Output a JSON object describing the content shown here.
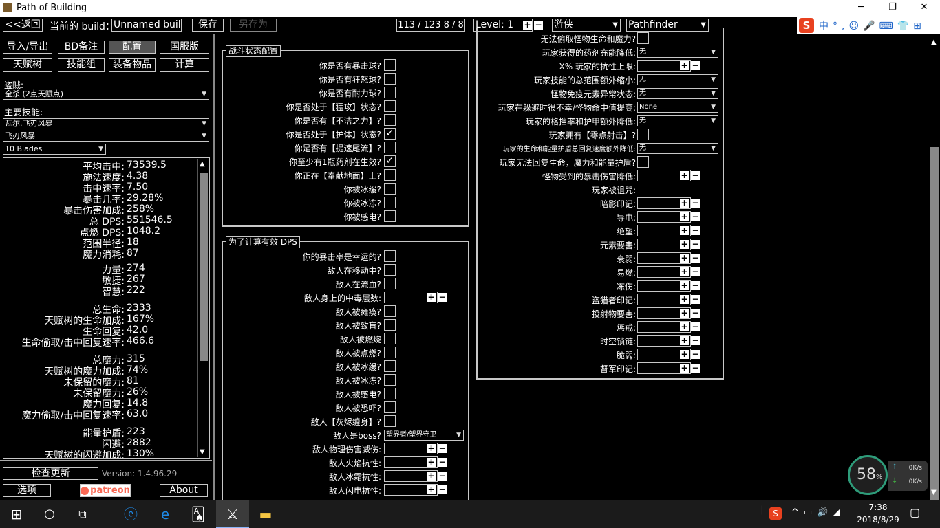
{
  "window": {
    "title": "Path of Building",
    "min": "─",
    "max": "❐",
    "close": "✕"
  },
  "toolbar": {
    "back": "<<返回",
    "build_label": "当前的 build：",
    "build_name": "Unnamed build",
    "save": "保存",
    "save_as": "另存为",
    "points": "113 / 123   8 / 8",
    "level": "Level: 1",
    "class": "游侠",
    "ascendancy": "Pathfinder"
  },
  "left": {
    "tabs1": [
      "导入/导出",
      "BD备注",
      "配置",
      "国服版"
    ],
    "tabs2": [
      "天赋树",
      "技能组",
      "装备物品",
      "计算"
    ],
    "bandit_label": "盗贼:",
    "bandit_value": "全杀 (2点天赋点)",
    "skill_label": "主要技能:",
    "skill1": "瓦尔.飞刃风暴",
    "skill2": "飞刃风暴",
    "skill3": "10 Blades",
    "check_update": "检查更新",
    "version": "Version: 1.4.96.29",
    "options": "选项",
    "patreon": "patreon",
    "about": "About"
  },
  "stats": [
    {
      "k": "平均击中:",
      "v": "73539.5"
    },
    {
      "k": "施法速度:",
      "v": "4.38"
    },
    {
      "k": "击中速率:",
      "v": "7.50"
    },
    {
      "k": "暴击几率:",
      "v": "29.28%"
    },
    {
      "k": "暴击伤害加成:",
      "v": "258%"
    },
    {
      "k": "总 DPS:",
      "v": "551546.5"
    },
    {
      "k": "点燃 DPS:",
      "v": "1048.2"
    },
    {
      "k": "范围半径:",
      "v": "18"
    },
    {
      "k": "魔力消耗:",
      "v": "87"
    },
    {
      "k": "力量:",
      "v": "274"
    },
    {
      "k": "敏捷:",
      "v": "267"
    },
    {
      "k": "智慧:",
      "v": "222"
    },
    {
      "k": "总生命:",
      "v": "2333"
    },
    {
      "k": "天赋树的生命加成:",
      "v": "167%"
    },
    {
      "k": "生命回复:",
      "v": "42.0"
    },
    {
      "k": "生命偷取/击中回复速率:",
      "v": "466.6"
    },
    {
      "k": "总魔力:",
      "v": "315"
    },
    {
      "k": "天赋树的魔力加成:",
      "v": "74%"
    },
    {
      "k": "未保留的魔力:",
      "v": "81"
    },
    {
      "k": "未保留魔力:",
      "v": "26%"
    },
    {
      "k": "魔力回复:",
      "v": "14.8"
    },
    {
      "k": "魔力偷取/击中回复速率:",
      "v": "63.0"
    },
    {
      "k": "能量护盾:",
      "v": "223"
    },
    {
      "k": "闪避:",
      "v": "2882"
    },
    {
      "k": "天赋树的闪避加成:",
      "v": "130%"
    }
  ],
  "combat": {
    "title": "战斗状态配置",
    "rows": [
      {
        "label": "你是否有暴击球?",
        "checked": ""
      },
      {
        "label": "你是否有狂怒球?",
        "checked": ""
      },
      {
        "label": "你是否有耐力球?",
        "checked": ""
      },
      {
        "label": "你是否处于【猛攻】状态?",
        "checked": ""
      },
      {
        "label": "你是否有【不洁之力】?",
        "checked": ""
      },
      {
        "label": "你是否处于【护体】状态?",
        "checked": "✓"
      },
      {
        "label": "你是否有【提速尾流】?",
        "checked": ""
      },
      {
        "label": "你至少有1瓶药剂在生效?",
        "checked": "✓"
      },
      {
        "label": "你正在【奉献地面】上?",
        "checked": ""
      },
      {
        "label": "你被冰缓?",
        "checked": ""
      },
      {
        "label": "你被冰冻?",
        "checked": ""
      },
      {
        "label": "你被感电?",
        "checked": ""
      }
    ]
  },
  "dps": {
    "title": "为了计算有效 DPS",
    "rows": [
      {
        "label": "你的暴击率是幸运的?",
        "type": "cb"
      },
      {
        "label": "敌人在移动中?",
        "type": "cb"
      },
      {
        "label": "敌人在流血?",
        "type": "cb"
      },
      {
        "label": "敌人身上的中毒层数:",
        "type": "num"
      },
      {
        "label": "敌人被瘫痪?",
        "type": "cb"
      },
      {
        "label": "敌人被致盲?",
        "type": "cb"
      },
      {
        "label": "敌人被燃烧",
        "type": "cb"
      },
      {
        "label": "敌人被点燃?",
        "type": "cb"
      },
      {
        "label": "敌人被冰缓?",
        "type": "cb"
      },
      {
        "label": "敌人被冰冻?",
        "type": "cb"
      },
      {
        "label": "敌人被感电?",
        "type": "cb"
      },
      {
        "label": "敌人被恐吓?",
        "type": "cb"
      },
      {
        "label": "敌人【灰烬缠身】?",
        "type": "cb"
      },
      {
        "label": "敌人是boss?",
        "type": "dd",
        "value": "塑界者/塑界守卫"
      },
      {
        "label": "敌人物理伤害减伤:",
        "type": "num"
      },
      {
        "label": "敌人火焰抗性:",
        "type": "num"
      },
      {
        "label": "敌人冰霜抗性:",
        "type": "num"
      },
      {
        "label": "敌人闪电抗性:",
        "type": "num"
      }
    ]
  },
  "right": {
    "rows": [
      {
        "label": "无法偷取怪物生命和魔力?",
        "type": "cb"
      },
      {
        "label": "玩家获得的药剂充能降低:",
        "type": "dd",
        "value": "无"
      },
      {
        "label": "-X% 玩家的抗性上限:",
        "type": "num"
      },
      {
        "label": "玩家技能的总范围额外缩小:",
        "type": "dd",
        "value": "无"
      },
      {
        "label": "怪物免疫元素异常状态:",
        "type": "dd",
        "value": "无"
      },
      {
        "label": "玩家在躲避时很不幸/怪物命中值提高:",
        "type": "dd",
        "value": "None"
      },
      {
        "label": "玩家的格挡率和护甲额外降低:",
        "type": "dd",
        "value": "无"
      },
      {
        "label": "玩家拥有【零点射击】?",
        "type": "cb"
      },
      {
        "label": "玩家的生命和能量护盾总回复速度额外降低:",
        "type": "dd",
        "value": "无"
      },
      {
        "label": "玩家无法回复生命，魔力和能量护盾?",
        "type": "cb"
      },
      {
        "label": "怪物受到的暴击伤害降低:",
        "type": "num"
      },
      {
        "label": "玩家被诅咒:",
        "type": "none"
      },
      {
        "label": "暗影印记:",
        "type": "num"
      },
      {
        "label": "导电:",
        "type": "num"
      },
      {
        "label": "绝望:",
        "type": "num"
      },
      {
        "label": "元素要害:",
        "type": "num"
      },
      {
        "label": "衰弱:",
        "type": "num"
      },
      {
        "label": "易燃:",
        "type": "num"
      },
      {
        "label": "冻伤:",
        "type": "num"
      },
      {
        "label": "盗猎者印记:",
        "type": "num"
      },
      {
        "label": "投射物要害:",
        "type": "num"
      },
      {
        "label": "惩戒:",
        "type": "num"
      },
      {
        "label": "时空锁链:",
        "type": "num"
      },
      {
        "label": "脆弱:",
        "type": "num"
      },
      {
        "label": "督军印记:",
        "type": "num"
      }
    ]
  },
  "ime": {
    "label": "中",
    "items": [
      "中",
      "°,",
      "☺",
      "🎤",
      "⌨",
      "👕",
      "⊞"
    ]
  },
  "net": {
    "percent": "58",
    "unit": "%",
    "up": "0K/s",
    "down": "0K/s"
  },
  "taskbar": {
    "time": "7:38",
    "date": "2018/8/29"
  }
}
